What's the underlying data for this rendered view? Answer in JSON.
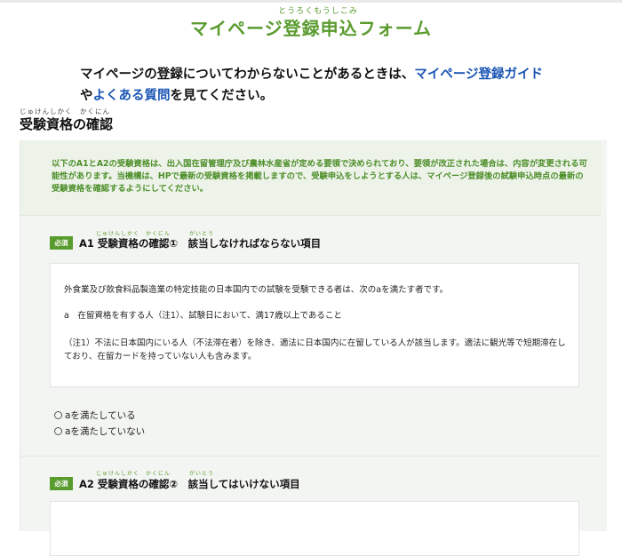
{
  "header": {
    "title_ruby": "とうろくもうしこみ",
    "title": "マイページ登録申込フォーム"
  },
  "intro": {
    "line1_prefix": "マイページの登録についてわからないことがあるときは、",
    "guide_link": "マイページ登録ガイド",
    "line2_prefix": "や",
    "faq_link": "よくある質問",
    "line2_suffix": "を見てください。"
  },
  "section": {
    "ruby": "じゅけんしかく　かくにん",
    "heading": "受験資格の確認"
  },
  "notice": {
    "text": "以下のA1とA2の受験資格は、出入国在留管理庁及び農林水産省が定める要領で決められており、要領が改正された場合は、内容が変更される可能性があります。当機構は、HPで最新の受験資格を掲載しますので、受験申込をしようとする人は、マイページ登録後の試験申込時点の最新の受験資格を確認するようにしてください。"
  },
  "questions": [
    {
      "badge": "必須",
      "ruby": "じゅけんしかく　かくにん　　　がいとう",
      "title": "A1 受験資格の確認①　該当しなければならない項目",
      "body": [
        "外食業及び飲食料品製造業の特定技能の日本国内での試験を受験できる者は、次のaを満たす者です。",
        "a　在留資格を有する人（注1）、試験日において、満17歳以上であること",
        "（注1）不法に日本国内にいる人（不法滞在者）を除き、適法に日本国内に在留している人が該当します。適法に観光等で短期滞在しており、在留カードを持っていない人も含みます。"
      ],
      "options": [
        "aを満たしている",
        "aを満たしていない"
      ]
    },
    {
      "badge": "必須",
      "ruby": "じゅけんしかく　かくにん　　　がいとう",
      "title": "A2 受験資格の確認②　該当してはいけない項目"
    }
  ],
  "colors": {
    "accent_green": "#5a9b2e",
    "link_blue": "#1a55b5",
    "panel_bg": "#f3f5f2"
  }
}
